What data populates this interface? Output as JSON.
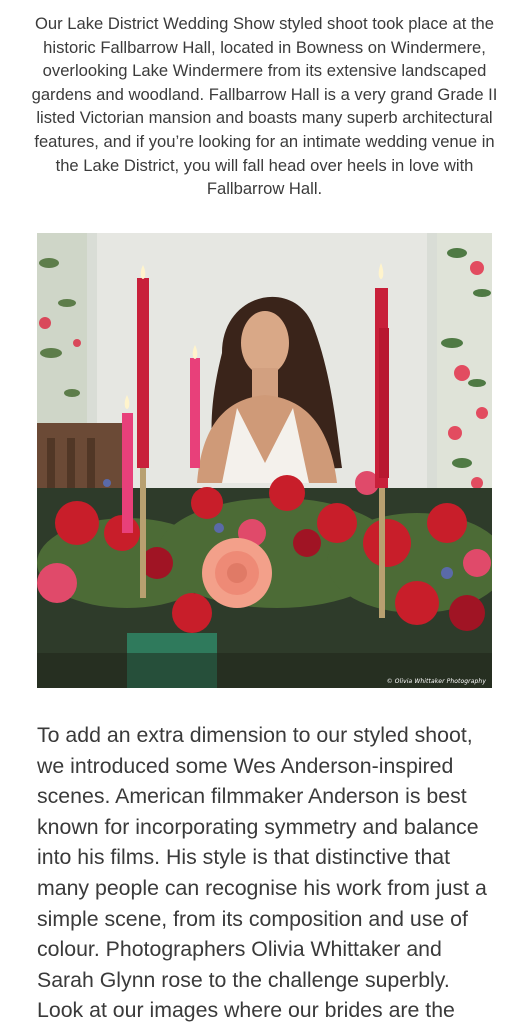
{
  "article": {
    "intro_paragraph": "Our Lake District Wedding Show styled shoot took place at the historic Fallbarrow Hall, located in Bowness on Windermere, overlooking Lake Windermere from its extensive landscaped gardens and woodland. Fallbarrow Hall is a very grand Grade II listed Victorian mansion and boasts many superb architectural features, and if you’re looking for an intimate wedding venue in the Lake District, you will fall head over heels in love with Fallbarrow Hall.",
    "photo": {
      "credit": "© Olivia Whittaker Photography",
      "icon": "photo-bride-at-floral-table"
    },
    "body_paragraph": "To add an extra dimension to our styled shoot, we introduced some Wes Anderson-inspired scenes. American filmmaker Anderson is best known for incorporating symmetry and balance into his films. His style is that distinctive that many people can recognise his work from just a simple scene, from its composition and use of colour. Photographers Olivia Whittaker and Sarah Glynn rose to the challenge superbly. Look at our images where our brides are the"
  },
  "colors": {
    "text": "#3a3a3a",
    "candle_red": "#c8203a",
    "candle_pink": "#e8407a",
    "rose_red": "#c81e2a",
    "peach_rose": "#f3a08a",
    "background": "#ffffff"
  }
}
